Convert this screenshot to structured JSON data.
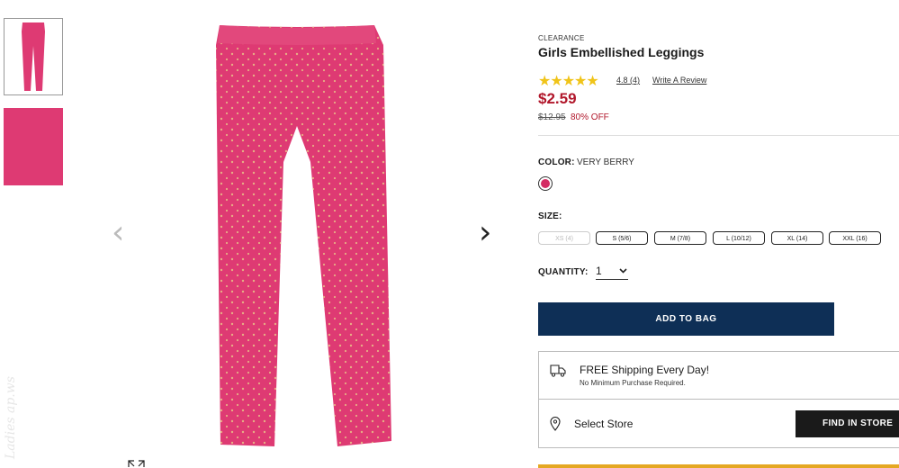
{
  "product": {
    "tag": "CLEARANCE",
    "title": "Girls Embellished Leggings",
    "stars": "★★★★★",
    "rating": "4.8",
    "review_count": "(4)",
    "write_review": "Write A Review",
    "price": "$2.59",
    "original_price": "$12.95",
    "discount": "80% OFF",
    "rating_value": 4.8
  },
  "color": {
    "label": "COLOR:",
    "value": "VERY BERRY",
    "swatch_hex": "#d42c63"
  },
  "size": {
    "label": "SIZE:",
    "options": [
      {
        "label": "XS (4)",
        "disabled": true
      },
      {
        "label": "S (5/6)",
        "disabled": false
      },
      {
        "label": "M (7/8)",
        "disabled": false
      },
      {
        "label": "L (10/12)",
        "disabled": false
      },
      {
        "label": "XL (14)",
        "disabled": false
      },
      {
        "label": "XXL (16)",
        "disabled": false
      }
    ]
  },
  "quantity": {
    "label": "QUANTITY:",
    "value": "1"
  },
  "add_to_bag": "ADD TO BAG",
  "shipping": {
    "title": "FREE Shipping Every Day!",
    "subtitle": "No Minimum Purchase Required."
  },
  "store": {
    "label": "Select Store",
    "button": "FIND IN STORE"
  },
  "gallery": {
    "prev_icon": "‹",
    "next_icon": "›"
  },
  "watermark": "Ladies ap.ws",
  "colors": {
    "brand_navy": "#0e2f56",
    "price_red": "#b1172b",
    "star_gold": "#f0c419",
    "legging_pink": "#de3a73"
  }
}
